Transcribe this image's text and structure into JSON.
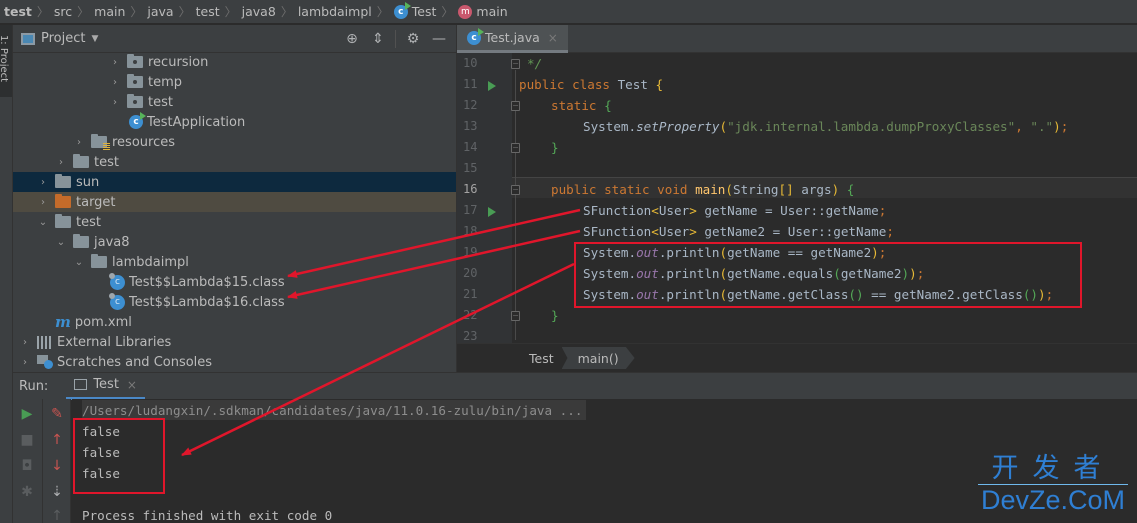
{
  "navbar": {
    "crumbs": [
      "test",
      "src",
      "main",
      "java",
      "test",
      "java8",
      "lambdaimpl",
      "Test",
      "main"
    ],
    "separator": "〉"
  },
  "left_stripe": {
    "project_tab": "1: Project"
  },
  "project_panel": {
    "title": "Project",
    "tools": [
      "locate-icon",
      "collapse-all-icon",
      "settings-icon",
      "hide-icon"
    ],
    "tree": [
      {
        "label": "recursion",
        "type": "package",
        "expanded": false
      },
      {
        "label": "temp",
        "type": "package",
        "expanded": false
      },
      {
        "label": "test",
        "type": "package",
        "expanded": false
      },
      {
        "label": "TestApplication",
        "type": "spring-app-class"
      },
      {
        "label": "resources",
        "type": "resources-folder",
        "expanded": false
      },
      {
        "label": "test",
        "type": "folder",
        "expanded": false
      },
      {
        "label": "sun",
        "type": "folder",
        "expanded": false,
        "selected": true
      },
      {
        "label": "target",
        "type": "excluded-folder",
        "expanded": false
      },
      {
        "label": "test",
        "type": "folder",
        "expanded": true
      },
      {
        "label": "java8",
        "type": "folder",
        "expanded": true
      },
      {
        "label": "lambdaimpl",
        "type": "folder",
        "expanded": true
      },
      {
        "label": "Test$$Lambda$15.class",
        "type": "class-file"
      },
      {
        "label": "Test$$Lambda$16.class",
        "type": "class-file"
      },
      {
        "label": "pom.xml",
        "type": "maven-file"
      },
      {
        "label": "External Libraries",
        "type": "libraries",
        "expanded": false
      },
      {
        "label": "Scratches and Consoles",
        "type": "scratches",
        "expanded": false
      }
    ]
  },
  "editor": {
    "tab": {
      "label": "Test.java",
      "close": "×"
    },
    "line_numbers": [
      "10",
      "11",
      "12",
      "13",
      "14",
      "15",
      "16",
      "17",
      "18",
      "19",
      "20",
      "21",
      "22",
      "23"
    ],
    "current_line": "16",
    "code": {
      "l10": "*/",
      "l11_kw": "public class ",
      "l11_name": "Test ",
      "l11_brace": "{",
      "l12_kw": "static ",
      "l12_brace": "{",
      "l13_obj": "System.",
      "l13_m": "setProperty",
      "l13_p1": "(",
      "l13_s1": "\"jdk.internal.lambda.dumpProxyClasses\"",
      "l13_comma": ", ",
      "l13_s2": "\".\"",
      "l13_p2": ")",
      "l13_semi": ";",
      "l14_brace": "}",
      "l16_kw": "public static void ",
      "l16_m": "main",
      "l16_p1": "(",
      "l16_t": "String",
      "l16_br": "[]",
      "l16_a": " args",
      "l16_p2": ")",
      "l16_sp": " ",
      "l16_brace": "{",
      "l17_t": "SFunction",
      "l17_g1": "<",
      "l17_gt": "User",
      "l17_g2": ">",
      "l17_rest": " getName = User::getName",
      "l17_semi": ";",
      "l18_t": "SFunction",
      "l18_g1": "<",
      "l18_gt": "User",
      "l18_g2": ">",
      "l18_rest": " getName2 = User::getName",
      "l18_semi": ";",
      "l19_a": "System.",
      "l19_f": "out",
      "l19_b": ".println",
      "l19_p1": "(",
      "l19_c": "getName == getName2",
      "l19_p2": ")",
      "l19_semi": ";",
      "l20_a": "System.",
      "l20_f": "out",
      "l20_b": ".println",
      "l20_p1": "(",
      "l20_c": "getName.equals",
      "l20_p3": "(",
      "l20_d": "getName2",
      "l20_p4": ")",
      "l20_p2": ")",
      "l20_semi": ";",
      "l21_a": "System.",
      "l21_f": "out",
      "l21_b": ".println",
      "l21_p1": "(",
      "l21_c": "getName.getClass",
      "l21_p3": "()",
      "l21_d": " == getName2.getClass",
      "l21_p4": "()",
      "l21_p2": ")",
      "l21_semi": ";",
      "l22_brace": "}"
    },
    "breadcrumbs": [
      "Test",
      "main()"
    ]
  },
  "run_panel": {
    "label": "Run:",
    "tab": {
      "label": "Test",
      "close": "×"
    },
    "tools_left": [
      "rerun-icon",
      "stop-icon",
      "screenshot-icon",
      "debug-icon"
    ],
    "tools_right": [
      "clear-icon",
      "up-icon",
      "down-icon",
      "sort-icon",
      "scroll-up-icon"
    ],
    "console": {
      "command": "/Users/ludangxin/.sdkman/candidates/java/11.0.16-zulu/bin/java ...",
      "output": [
        "false",
        "false",
        "false"
      ],
      "exit": "Process finished with exit code 0"
    }
  },
  "watermark": {
    "cn": "开发者",
    "en": "DevZe.CoM"
  },
  "colors": {
    "annotation": "#e0162b",
    "keyword": "#cc7832",
    "string": "#6a8759",
    "method": "#ffc66d"
  }
}
